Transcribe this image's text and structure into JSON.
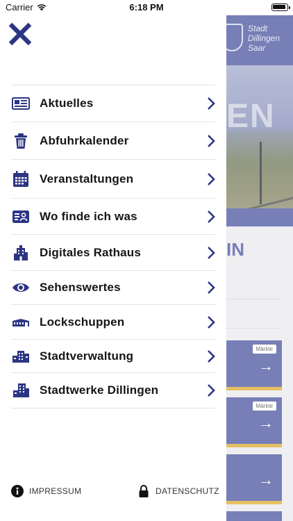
{
  "status_bar": {
    "carrier": "Carrier",
    "time": "6:18 PM"
  },
  "background": {
    "logo_line1": "Stadt",
    "logo_line2": "Dillingen",
    "logo_line3": "Saar",
    "hero_text": "EN",
    "section_title": "IN",
    "cards": [
      {
        "tag": "Märkte",
        "arrow": "→"
      },
      {
        "tag": "Märkte",
        "arrow": "→"
      },
      {
        "tag": "",
        "arrow": "→"
      }
    ]
  },
  "drawer": {
    "menu_items": [
      {
        "label": "Aktuelles",
        "icon": "newspaper-icon"
      },
      {
        "label": "Abfuhrkalender",
        "icon": "trash-icon"
      },
      {
        "label": "Veranstaltungen",
        "icon": "calendar-icon"
      },
      {
        "label": "Wo finde ich was",
        "icon": "directory-icon"
      },
      {
        "label": "Digitales Rathaus",
        "icon": "town-hall-icon"
      },
      {
        "label": "Sehenswertes",
        "icon": "eye-icon"
      },
      {
        "label": "Lockschuppen",
        "icon": "shed-icon"
      },
      {
        "label": "Stadtverwaltung",
        "icon": "administration-building-icon"
      },
      {
        "label": "Stadtwerke Dillingen",
        "icon": "utility-building-icon"
      }
    ],
    "footer": {
      "impressum": "IMPRESSUM",
      "datenschutz": "DATENSCHUTZ"
    }
  },
  "colors": {
    "accent": "#2c3584",
    "bg_blue": "#5a63a6",
    "gold": "#e0b343"
  }
}
